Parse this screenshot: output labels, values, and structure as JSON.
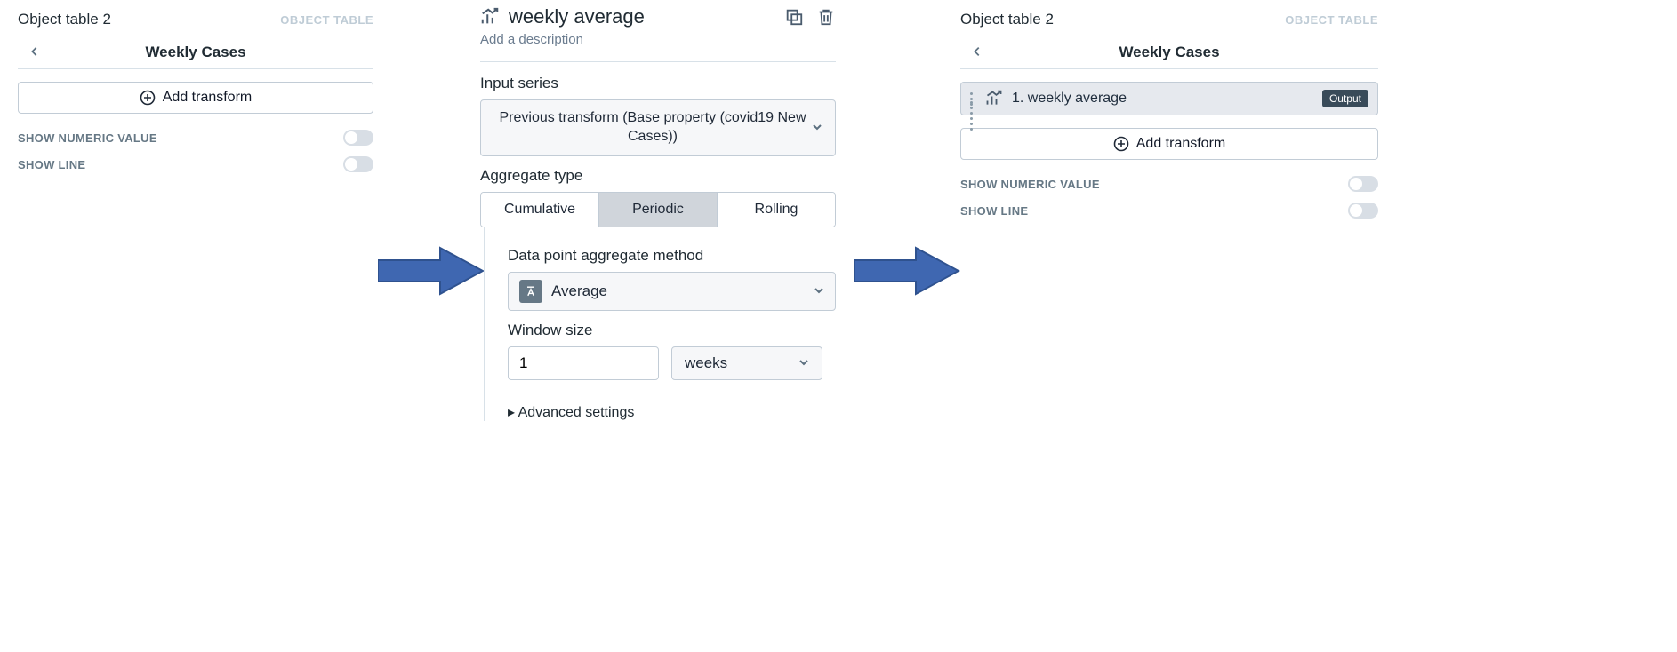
{
  "left": {
    "panel_title": "Object table 2",
    "panel_tag": "OBJECT TABLE",
    "breadcrumb": "Weekly Cases",
    "add_transform": "Add transform",
    "toggles": [
      {
        "label": "SHOW NUMERIC VALUE",
        "on": false
      },
      {
        "label": "SHOW LINE",
        "on": false
      }
    ]
  },
  "middle": {
    "title": "weekly average",
    "description_placeholder": "Add a description",
    "input_series_label": "Input series",
    "input_series_value": "Previous transform (Base property (covid19 New Cases))",
    "aggregate_type_label": "Aggregate type",
    "aggregate_types": [
      "Cumulative",
      "Periodic",
      "Rolling"
    ],
    "aggregate_selected": "Periodic",
    "method_label": "Data point aggregate method",
    "method_value": "Average",
    "window_label": "Window size",
    "window_value": "1",
    "window_unit": "weeks",
    "advanced": "Advanced settings"
  },
  "right": {
    "panel_title": "Object table 2",
    "panel_tag": "OBJECT TABLE",
    "breadcrumb": "Weekly Cases",
    "transform": {
      "label": "1. weekly average",
      "badge": "Output"
    },
    "add_transform": "Add transform",
    "toggles": [
      {
        "label": "SHOW NUMERIC VALUE",
        "on": false
      },
      {
        "label": "SHOW LINE",
        "on": false
      }
    ]
  }
}
